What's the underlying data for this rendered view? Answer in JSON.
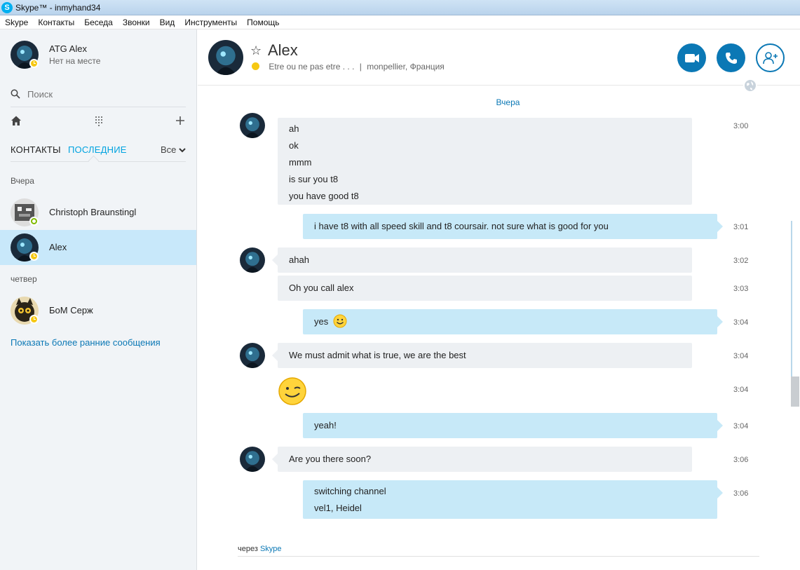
{
  "window": {
    "title": "Skype™ - inmyhand34"
  },
  "menu": [
    "Skype",
    "Контакты",
    "Беседа",
    "Звонки",
    "Вид",
    "Инструменты",
    "Помощь"
  ],
  "me": {
    "name": "ATG Alex",
    "status": "Нет на месте"
  },
  "search": {
    "placeholder": "Поиск"
  },
  "tabs": {
    "contacts": "КОНТАКТЫ",
    "recent": "ПОСЛЕДНИЕ",
    "filter": "Все"
  },
  "groups": [
    {
      "label": "Вчера",
      "contacts": [
        {
          "name": "Christoph Braunstingl",
          "status": "online"
        },
        {
          "name": "Alex",
          "status": "away",
          "selected": true
        }
      ]
    },
    {
      "label": "четвер",
      "contacts": [
        {
          "name": "БоМ Серж",
          "status": "away"
        }
      ]
    }
  ],
  "show_more": "Показать более ранние сообщения",
  "conversation": {
    "name": "Alex",
    "mood": "Etre ou ne pas etre . . .",
    "separator": "|",
    "location": "monpellier, Франция",
    "day_separator": "Вчера",
    "messages": [
      {
        "dir": "in",
        "lines": [
          "ah",
          "ok",
          "mmm",
          "is sur you t8",
          "you have good t8"
        ],
        "time": "3:00"
      },
      {
        "dir": "out",
        "lines": [
          "i have t8 with all speed skill and t8 coursair. not sure what is good for you"
        ],
        "time": "3:01"
      },
      {
        "dir": "in",
        "lines": [
          "ahah"
        ],
        "time": "3:02"
      },
      {
        "dir": "in",
        "lines": [
          "Oh you call alex"
        ],
        "time": "3:03"
      },
      {
        "dir": "out",
        "lines": [
          "yes"
        ],
        "emoji": "smile",
        "time": "3:04"
      },
      {
        "dir": "in",
        "lines": [
          "We must admit what is true, we are the best"
        ],
        "time": "3:04"
      },
      {
        "dir": "in",
        "emoji": "wink",
        "time": "3:04"
      },
      {
        "dir": "out",
        "lines": [
          "yeah!"
        ],
        "time": "3:04"
      },
      {
        "dir": "in",
        "lines": [
          "Are you there soon?"
        ],
        "time": "3:06"
      },
      {
        "dir": "out",
        "lines": [
          "switching channel",
          "vel1, Heidel"
        ],
        "time": "3:06"
      }
    ],
    "via_label": "через",
    "via_link": "Skype"
  },
  "icons": [
    "skype-logo-icon",
    "search-icon",
    "home-icon",
    "dialpad-icon",
    "plus-icon",
    "chevron-down-icon",
    "star-icon",
    "video-call-icon",
    "audio-call-icon",
    "add-contact-icon",
    "globe-icon"
  ],
  "colors": {
    "accent": "#0b78b5",
    "selected": "#c8e8fa",
    "outgoing_bubble": "#c7e9f8",
    "incoming_bubble": "#edf0f3",
    "away": "#f6c813",
    "online": "#7fba00"
  }
}
